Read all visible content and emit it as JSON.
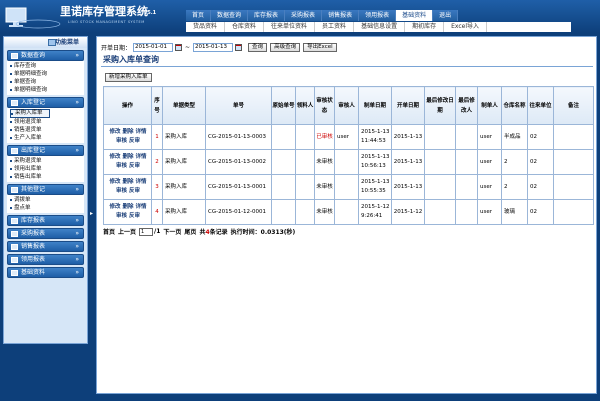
{
  "app": {
    "title": "里诺库存管理系统",
    "version": "v5.1",
    "subtitle": "LINO STOCK MANAGEMENT SYSTEM"
  },
  "top_nav": [
    "首页",
    "数据查询",
    "库存报表",
    "采购报表",
    "销售报表",
    "领用报表",
    "基础资料",
    "退出"
  ],
  "top_nav_active": 6,
  "sub_nav": [
    "货品资料",
    "仓库资料",
    "往来单位资料",
    "员工资料",
    "基础信息设置",
    "期初库存",
    "Excel导入"
  ],
  "sidebar": {
    "title": "功能菜单",
    "groups": [
      {
        "label": "数据查询",
        "items": [
          "库存查询",
          "单据明细查询",
          "单据查询",
          "单据明细查询"
        ]
      },
      {
        "label": "入库登记",
        "items": [
          "采购入库单",
          "领用退货单",
          "销售退货单",
          "生产入库单"
        ],
        "active": 0
      },
      {
        "label": "出库登记",
        "items": [
          "采购退货单",
          "领用出库单",
          "销售出库单"
        ]
      },
      {
        "label": "其他登记",
        "items": [
          "调拨单",
          "盘点单"
        ]
      },
      {
        "label": "库存报表",
        "items": []
      },
      {
        "label": "采购报表",
        "items": []
      },
      {
        "label": "销售报表",
        "items": []
      },
      {
        "label": "领用报表",
        "items": []
      },
      {
        "label": "基础资料",
        "items": []
      }
    ]
  },
  "filter": {
    "start_label": "开单日期：",
    "start_value": "2015-01-01",
    "end_value": "2015-01-13",
    "query_btn": "查询",
    "advanced_btn": "高级查询",
    "export_btn": "导出Excel"
  },
  "page_title": "采购入库单查询",
  "new_btn": "新增采购入库单",
  "table": {
    "columns": [
      "操作",
      "序号",
      "单据类型",
      "单号",
      "原始单号",
      "领料人",
      "审核状态",
      "审核人",
      "制单日期",
      "开单日期",
      "最后修改日期",
      "最后修改人",
      "制单人",
      "仓库名称",
      "往来单位",
      "备注"
    ],
    "actions": [
      "修改",
      "删除",
      "详情",
      "审核",
      "反审"
    ],
    "rows": [
      {
        "seq": "1",
        "type": "采购入库",
        "no": "CG-2015-01-13-0003",
        "orig": "",
        "picker": "",
        "status": "已审核",
        "auditor": "user",
        "created": "2015-1-13 11:44:53",
        "opened": "2015-1-13",
        "modified": "",
        "modifier": "",
        "maker": "user",
        "warehouse": "半成品",
        "partner": "02",
        "remark": ""
      },
      {
        "seq": "2",
        "type": "采购入库",
        "no": "CG-2015-01-13-0002",
        "orig": "",
        "picker": "",
        "status": "未审核",
        "auditor": "",
        "created": "2015-1-13 10:56:13",
        "opened": "2015-1-13",
        "modified": "",
        "modifier": "",
        "maker": "user",
        "warehouse": "2",
        "partner": "02",
        "remark": ""
      },
      {
        "seq": "3",
        "type": "采购入库",
        "no": "CG-2015-01-13-0001",
        "orig": "",
        "picker": "",
        "status": "未审核",
        "auditor": "",
        "created": "2015-1-13 10:55:35",
        "opened": "2015-1-13",
        "modified": "",
        "modifier": "",
        "maker": "user",
        "warehouse": "2",
        "partner": "02",
        "remark": ""
      },
      {
        "seq": "4",
        "type": "采购入库",
        "no": "CG-2015-01-12-0001",
        "orig": "",
        "picker": "",
        "status": "未审核",
        "auditor": "",
        "created": "2015-1-12 9:26:41",
        "opened": "2015-1-12",
        "modified": "",
        "modifier": "",
        "maker": "user",
        "warehouse": "玻璃",
        "partner": "02",
        "remark": ""
      }
    ]
  },
  "pager": {
    "first": "首页",
    "prev": "上一页",
    "page": "1",
    "total_pages": "/1",
    "next": "下一页",
    "last": "尾页",
    "count_prefix": "共",
    "count": "4",
    "count_suffix": "条记录",
    "exec": "执行时间：0.0313(秒)"
  },
  "colors": {
    "accent": "#1a4c88",
    "header": "#0d3f7a",
    "approved": "#cc0000"
  }
}
